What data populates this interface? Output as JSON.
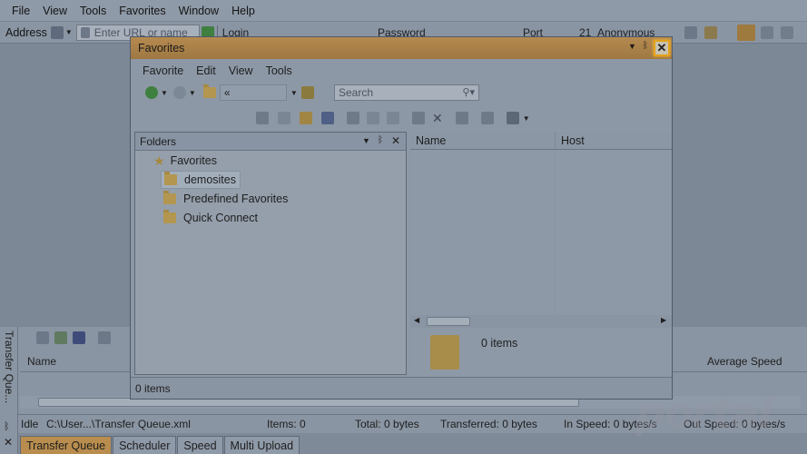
{
  "menubar": {
    "items": [
      "File",
      "View",
      "Tools",
      "Favorites",
      "Window",
      "Help"
    ]
  },
  "addressbar": {
    "address_label": "Address",
    "url_placeholder": "Enter URL or name",
    "login_label": "Login",
    "password_label": "Password",
    "port_label": "Port",
    "port_value": "21",
    "anonymous_label": "Anonymous"
  },
  "transfer_queue": {
    "side_tab_label": "Transfer Que...",
    "col_name": "Name",
    "col_average_speed": "Average Speed"
  },
  "statusbar": {
    "state": "Idle",
    "file": "C:\\User...\\Transfer Queue.xml",
    "items": "Items: 0",
    "total": "Total: 0 bytes",
    "transferred": "Transferred: 0 bytes",
    "in_speed": "In Speed: 0 bytes/s",
    "out_speed": "Out Speed: 0 bytes/s"
  },
  "bottom_tabs": [
    "Transfer Queue",
    "Scheduler",
    "Speed",
    "Multi Upload"
  ],
  "dialog": {
    "title": "Favorites",
    "menu": [
      "Favorite",
      "Edit",
      "View",
      "Tools"
    ],
    "nav_path": "«",
    "search_placeholder": "Search",
    "folders_pane": {
      "title": "Folders",
      "root": "Favorites",
      "children": [
        "demosites",
        "Predefined Favorites",
        "Quick Connect"
      ]
    },
    "list": {
      "col_name": "Name",
      "col_host": "Host",
      "empty_text": "0 items"
    },
    "status": "0 items"
  },
  "watermark": "portal",
  "colors": {
    "title_bar": "#b58a4f",
    "close_highlight": "#e3a21a",
    "active_tab": "#b88d4e"
  },
  "icons": [
    "address-icon",
    "url-icon",
    "go-arrow-icon",
    "favorites-star-icon",
    "back-icon",
    "forward-icon",
    "folder-icon",
    "up-folder-icon",
    "search-icon",
    "close-icon",
    "pin-icon"
  ]
}
